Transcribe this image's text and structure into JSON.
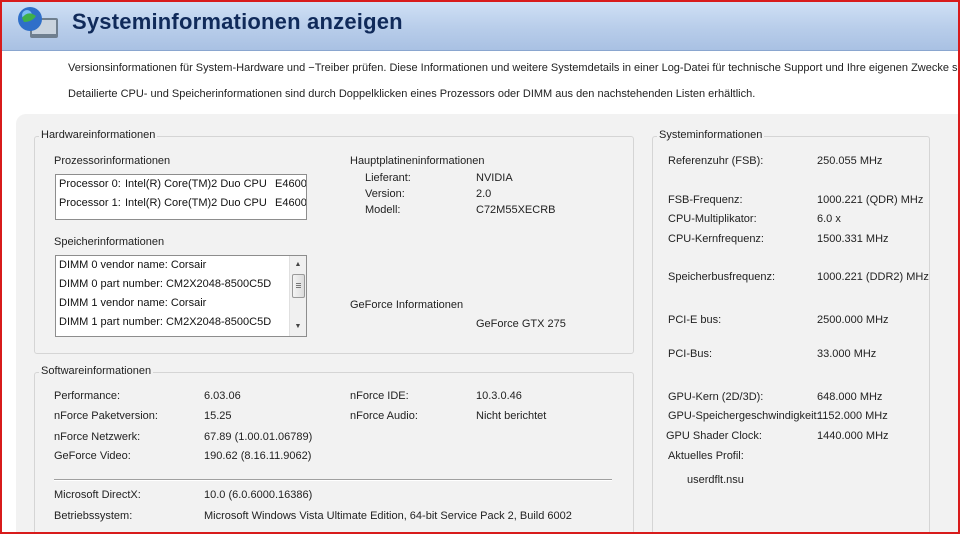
{
  "header": {
    "title": "Systeminformationen anzeigen"
  },
  "description": {
    "line1": "Versionsinformationen für System-Hardware und −Treiber prüfen.  Diese Informationen und weitere Systemdetails in einer Log-Datei für technische Support und Ihre eigenen Zwecke speicher",
    "line2": "Detailierte CPU- und Speicherinformationen sind durch Doppelklicken eines Prozessors oder DIMM aus den nachstehenden Listen erhältlich."
  },
  "hardware": {
    "title": "Hardwareinformationen",
    "processor": {
      "title": "Prozessorinformationen",
      "rows": [
        {
          "name": "Processor 0:",
          "model": "Intel(R) Core(TM)2 Duo CPU",
          "tag": "E4600"
        },
        {
          "name": "Processor 1:",
          "model": "Intel(R) Core(TM)2 Duo CPU",
          "tag": "E4600"
        }
      ]
    },
    "memory": {
      "title": "Speicherinformationen",
      "rows": [
        "DIMM 0 vendor name: Corsair",
        "DIMM 0 part number: CM2X2048-8500C5D",
        "DIMM 1 vendor name: Corsair",
        "DIMM 1 part number: CM2X2048-8500C5D"
      ]
    },
    "mainboard": {
      "title": "Hauptplatineninformationen",
      "items": [
        {
          "label": "Lieferant:",
          "value": "NVIDIA"
        },
        {
          "label": "Version:",
          "value": "2.0"
        },
        {
          "label": "Modell:",
          "value": "C72M55XECRB"
        }
      ]
    },
    "geforce": {
      "title": "GeForce Informationen",
      "value": "GeForce GTX 275"
    }
  },
  "software": {
    "title": "Softwareinformationen",
    "left": [
      {
        "label": "Performance:",
        "value": "6.03.06"
      },
      {
        "label": "nForce Paketversion:",
        "value": "15.25"
      },
      {
        "label": "nForce Netzwerk:",
        "value": "67.89 (1.00.01.06789)"
      },
      {
        "label": "GeForce Video:",
        "value": "190.62 (8.16.11.9062)"
      }
    ],
    "right": [
      {
        "label": "nForce IDE:",
        "value": "10.3.0.46"
      },
      {
        "label": "nForce Audio:",
        "value": "Nicht berichtet"
      }
    ],
    "bottom": [
      {
        "label": "Microsoft DirectX:",
        "value": "10.0 (6.0.6000.16386)"
      },
      {
        "label": "Betriebssystem:",
        "value": "Microsoft Windows Vista Ultimate Edition, 64-bit Service Pack 2, Build 6002"
      }
    ]
  },
  "system": {
    "title": "Systeminformationen",
    "items": [
      {
        "label": "Referenzuhr (FSB):",
        "value": "250.055  MHz"
      },
      {
        "label": "FSB-Frequenz:",
        "value": "1000.221 (QDR) MHz"
      },
      {
        "label": "CPU-Multiplikator:",
        "value": "6.0 x"
      },
      {
        "label": "CPU-Kernfrequenz:",
        "value": "1500.331 MHz"
      },
      {
        "label": "Speicherbusfrequenz:",
        "value": "1000.221 (DDR2) MHz"
      },
      {
        "label": "PCI-E bus:",
        "value": "2500.000 MHz"
      },
      {
        "label": "PCI-Bus:",
        "value": "33.000  MHz"
      },
      {
        "label": "GPU-Kern (2D/3D):",
        "value": "648.000 MHz"
      },
      {
        "label": "GPU-Speichergeschwindigkeit:",
        "value": "1152.000 MHz"
      },
      {
        "label": "GPU Shader Clock:",
        "value": "1440.000 MHz"
      },
      {
        "label": "Aktuelles Profil:",
        "value": ""
      }
    ],
    "profile": "userdflt.nsu"
  }
}
